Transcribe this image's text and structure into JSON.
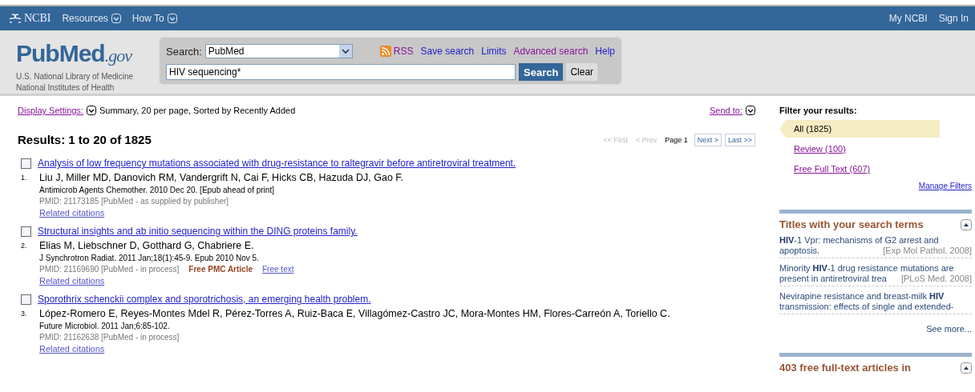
{
  "topbar": {
    "brand": "NCBI",
    "menus": [
      {
        "label": "Resources"
      },
      {
        "label": "How To"
      }
    ],
    "links": [
      "My NCBI",
      "Sign In"
    ]
  },
  "header": {
    "logo": {
      "name": "PubMed",
      "suffix": ".gov"
    },
    "org_lines": [
      "U.S. National Library of Medicine",
      "National Institutes of Health"
    ],
    "search": {
      "label": "Search:",
      "database": "PubMed",
      "value": "HIV sequencing*",
      "button": "Search",
      "clear": "Clear",
      "links": [
        {
          "label": "RSS",
          "kind": "rss",
          "visited": true
        },
        {
          "label": "Save search",
          "kind": "link",
          "visited": false
        },
        {
          "label": "Limits",
          "kind": "link",
          "visited": false
        },
        {
          "label": "Advanced search",
          "kind": "link",
          "visited": true
        },
        {
          "label": "Help",
          "kind": "link",
          "visited": false
        }
      ]
    }
  },
  "display": {
    "link": "Display Settings:",
    "summary": "Summary, 20 per page, Sorted by Recently Added",
    "send_to": "Send to:"
  },
  "results": {
    "heading": "Results: 1 to 20 of 1825",
    "pager": [
      {
        "label": "<< First",
        "kind": "disabled"
      },
      {
        "label": "< Prev",
        "kind": "disabled"
      },
      {
        "label": "Page 1",
        "kind": "current"
      },
      {
        "label": "Next >",
        "kind": "button"
      },
      {
        "label": "Last >>",
        "kind": "button"
      }
    ],
    "items": [
      {
        "number": "1.",
        "checked": false,
        "title": "Analysis of low frequency mutations associated with drug-resistance to raltegravir before antiretroviral treatment.",
        "authors": "Liu J, Miller MD, Danovich RM, Vandergrift N, Cai F, Hicks CB, Hazuda DJ, Gao F.",
        "journal": "Antimicrob Agents Chemother. 2010 Dec 20. [Epub ahead of print]",
        "pmid": "PMID: 21173185 [PubMed - as supplied by publisher]",
        "related": "Related citations"
      },
      {
        "number": "2.",
        "checked": false,
        "title": "Structural insights and ab initio sequencing within the DING proteins family.",
        "authors": "Elias M, Liebschner D, Gotthard G, Chabriere E.",
        "journal": "J Synchrotron Radiat. 2011 Jan;18(1):45-9. Epub 2010 Nov 5.",
        "pmid": "PMID: 21169690 [PubMed - in process]",
        "extras": [
          {
            "label": "Free PMC Article",
            "kind": "badge"
          },
          {
            "label": "Free text",
            "kind": "link"
          }
        ],
        "related": "Related citations"
      },
      {
        "number": "3.",
        "checked": false,
        "title": "Sporothrix schenckii complex and sporotrichosis, an emerging health problem.",
        "authors": "López-Romero E, Reyes-Montes Mdel R, Pérez-Torres A, Ruiz-Baca E, Villagómez-Castro JC, Mora-Montes HM, Flores-Carreón A, Toriello C.",
        "journal": "Future Microbiol. 2011 Jan;6:85-102.",
        "pmid": "PMID: 21162638 [PubMed - in process]",
        "related": "Related citations"
      }
    ]
  },
  "sidebar": {
    "filter_heading": "Filter your results:",
    "filters": [
      {
        "label": "All (1825)",
        "selected": true
      },
      {
        "label": "Review (100)",
        "selected": false
      },
      {
        "label": "Free Full Text (607)",
        "selected": false
      }
    ],
    "manage": "Manage Filters",
    "titles": {
      "heading": "Titles with your search terms",
      "items": [
        {
          "title": "**HIV**-1 Vpr: mechanisms of G2 arrest and apoptosis.",
          "source": "[Exp Mol Pathol. 2008]"
        },
        {
          "title": "Minority **HIV**-1 drug resistance mutations are present in antiretroviral trea",
          "source": "[PLoS Med. 2008]"
        },
        {
          "title": "Nevirapine resistance and breast-milk **HIV** transmission: effects of single and extended-"
        }
      ],
      "more": "See more..."
    },
    "free": {
      "heading": "403 free full-text articles in"
    }
  }
}
